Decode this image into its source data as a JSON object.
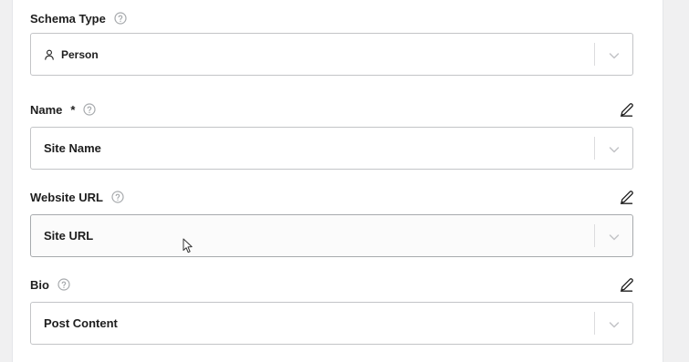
{
  "schema_type": {
    "label": "Schema Type",
    "value": "Person",
    "value_icon": "person-icon"
  },
  "name": {
    "label": "Name",
    "required_mark": "*",
    "value": "Site Name"
  },
  "website_url": {
    "label": "Website URL",
    "value": "Site URL"
  },
  "bio": {
    "label": "Bio",
    "value": "Post Content"
  },
  "colors": {
    "text": "#1e1e1e",
    "icon": "#1e1e1e",
    "border": "#c3c4c7",
    "chevron": "#c3c4c7"
  }
}
